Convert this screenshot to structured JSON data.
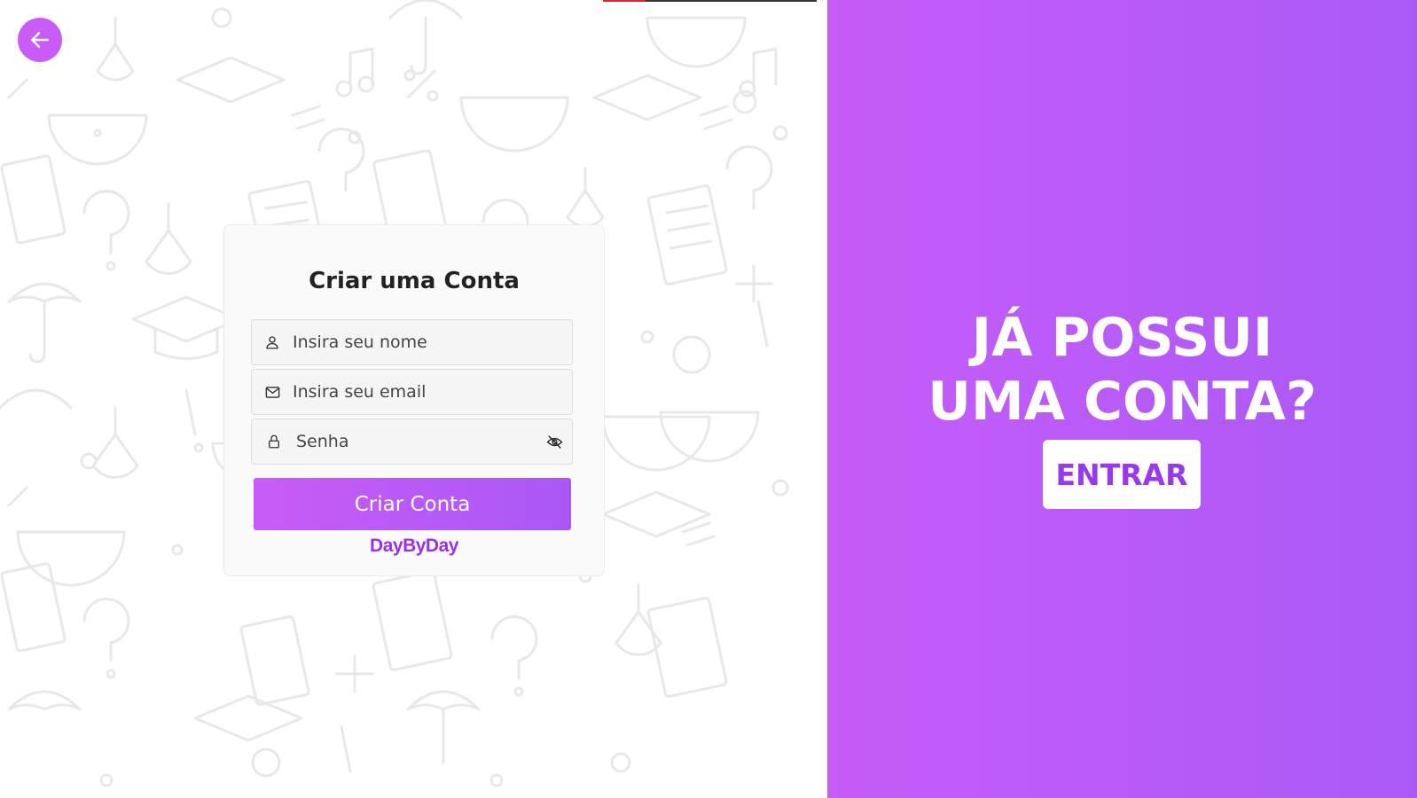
{
  "left_panel": {
    "back_button_icon": "arrow-left-icon"
  },
  "signup_card": {
    "title": "Criar uma Conta",
    "name_field": {
      "placeholder": "Insira seu nome",
      "value": "",
      "icon": "user-icon"
    },
    "email_field": {
      "placeholder": "Insira seu email",
      "value": "",
      "icon": "envelope-icon"
    },
    "password_field": {
      "placeholder": "Senha",
      "value": "",
      "icon": "lock-icon",
      "toggle_icon": "eye-off-icon"
    },
    "submit_label": "Criar Conta",
    "brand": "DayByDay"
  },
  "right_panel": {
    "title_line1": "JÁ POSSUI",
    "title_line2": "UMA CONTA?",
    "login_label": "ENTRAR"
  },
  "colors": {
    "accent": "#c95cf6",
    "accent_end": "#a958f5",
    "brand_text": "#9b30e6"
  }
}
